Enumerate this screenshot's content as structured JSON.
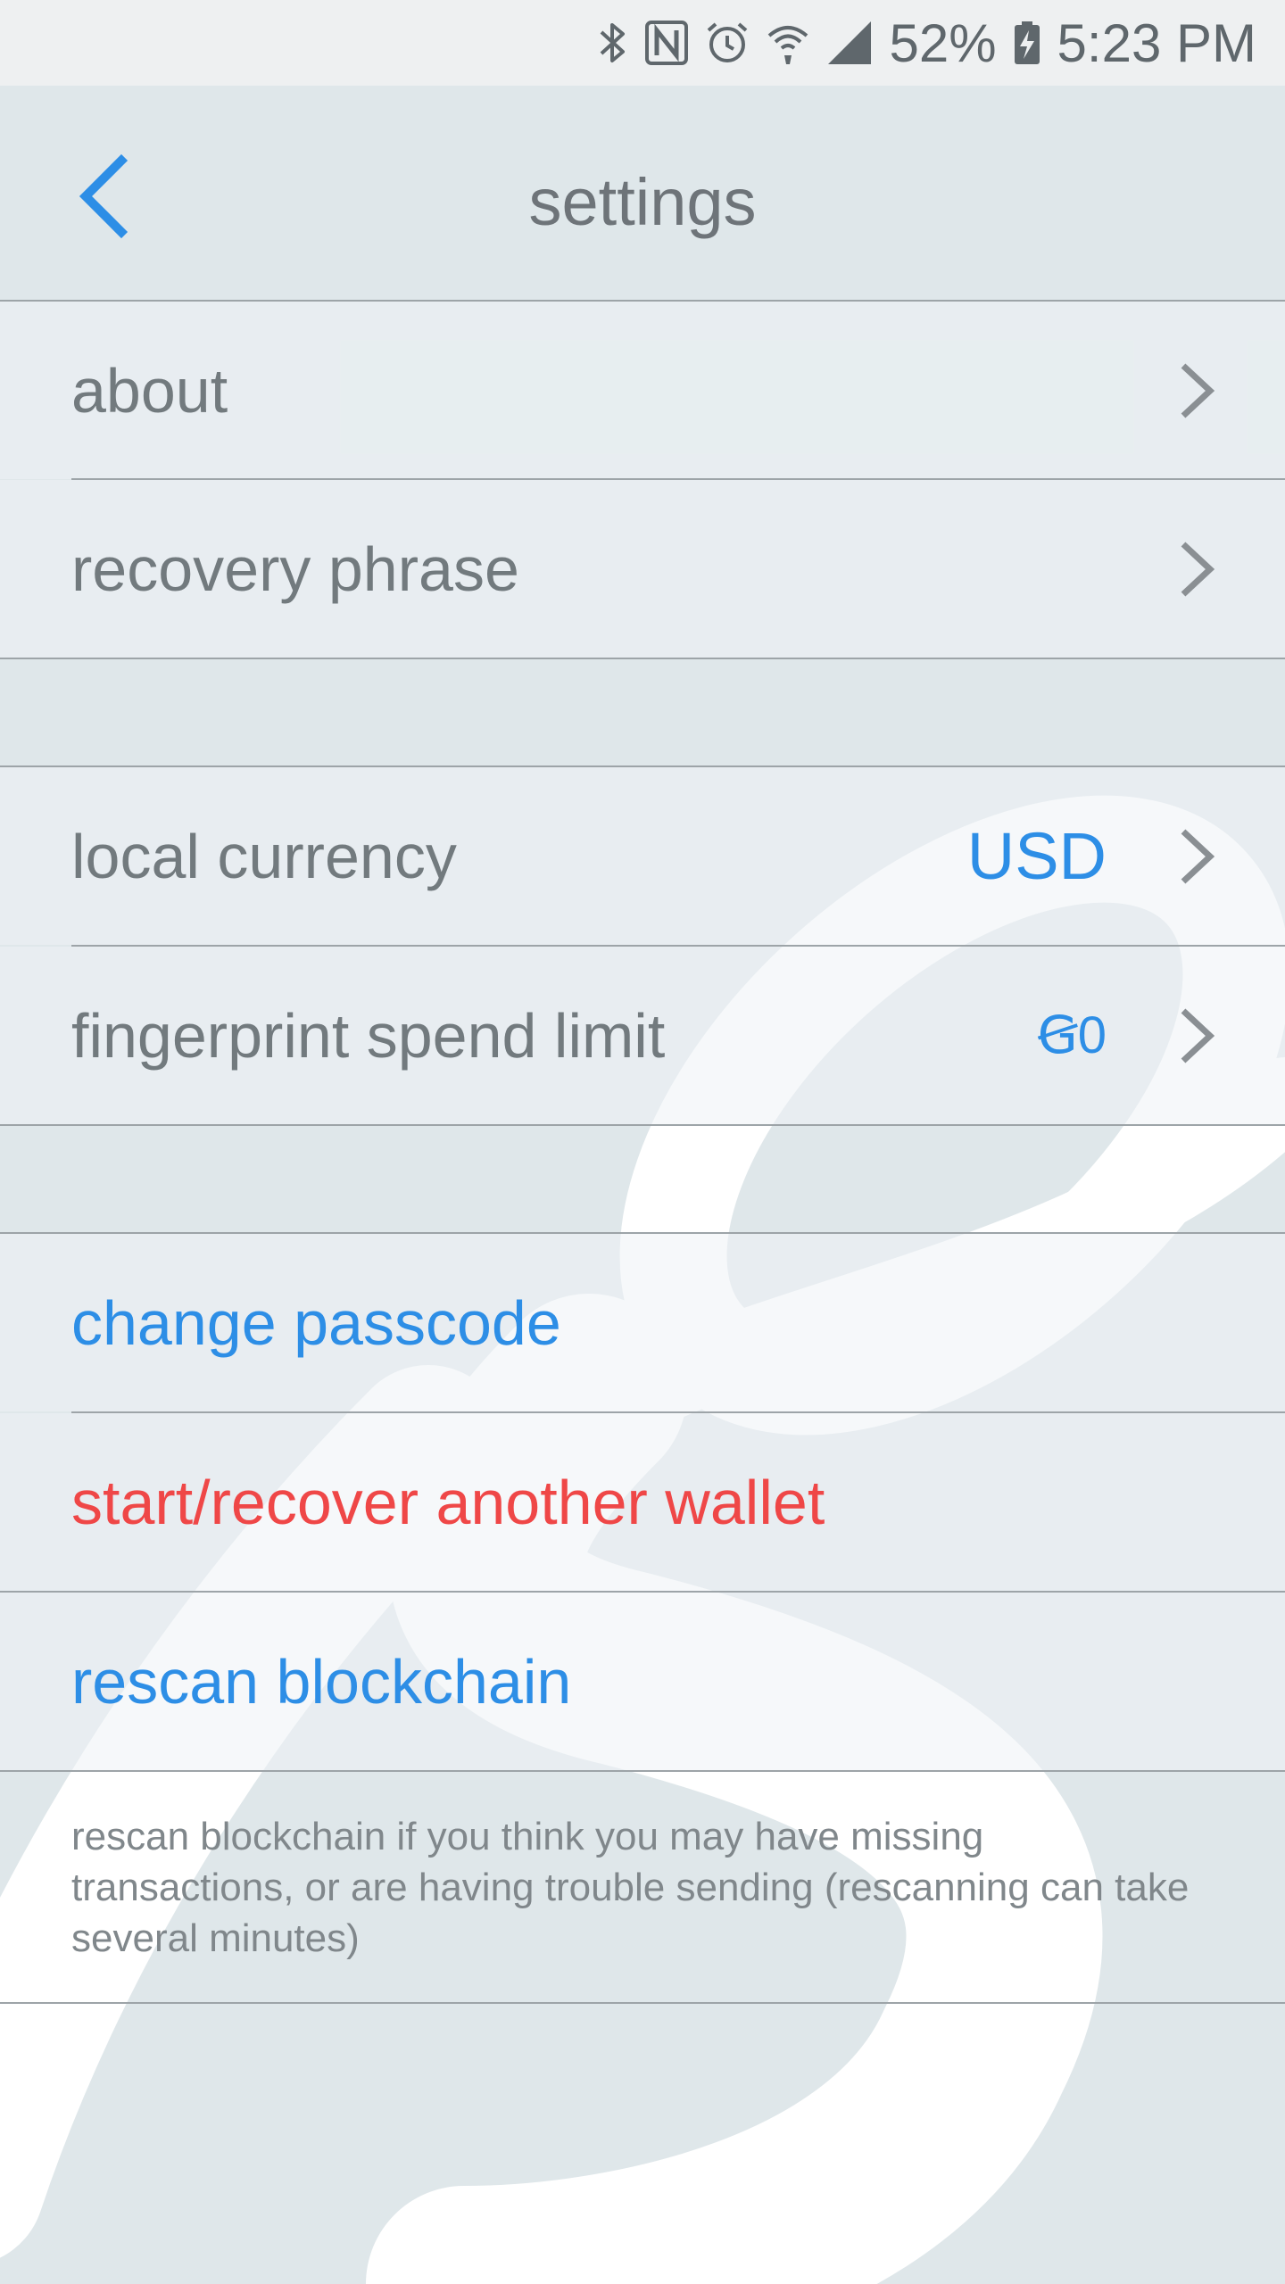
{
  "status_bar": {
    "icons": [
      "bluetooth-icon",
      "nfc-icon",
      "alarm-icon",
      "wifi-icon",
      "signal-icon",
      "battery-charging-icon"
    ],
    "battery": "52%",
    "time": "5:23 PM"
  },
  "header": {
    "title": "settings",
    "back_icon": "chevron-left-icon"
  },
  "sections": {
    "general": {
      "about": "about",
      "recovery_phrase": "recovery phrase"
    },
    "currency": {
      "local_currency_label": "local currency",
      "local_currency_value": "USD",
      "fingerprint_label": "fingerprint spend limit",
      "fingerprint_value": "Ꞡ0"
    },
    "wallet": {
      "change_passcode": "change passcode",
      "start_recover": "start/recover another wallet",
      "rescan": "rescan blockchain"
    }
  },
  "rescan_note": "rescan blockchain if you think you may have missing transactions, or are having trouble sending (rescanning can take several minutes)",
  "colors": {
    "accent_blue": "#2d8ee6",
    "danger_red": "#ef4747",
    "background": "#dfe7ea",
    "row_text": "#727a7e"
  }
}
